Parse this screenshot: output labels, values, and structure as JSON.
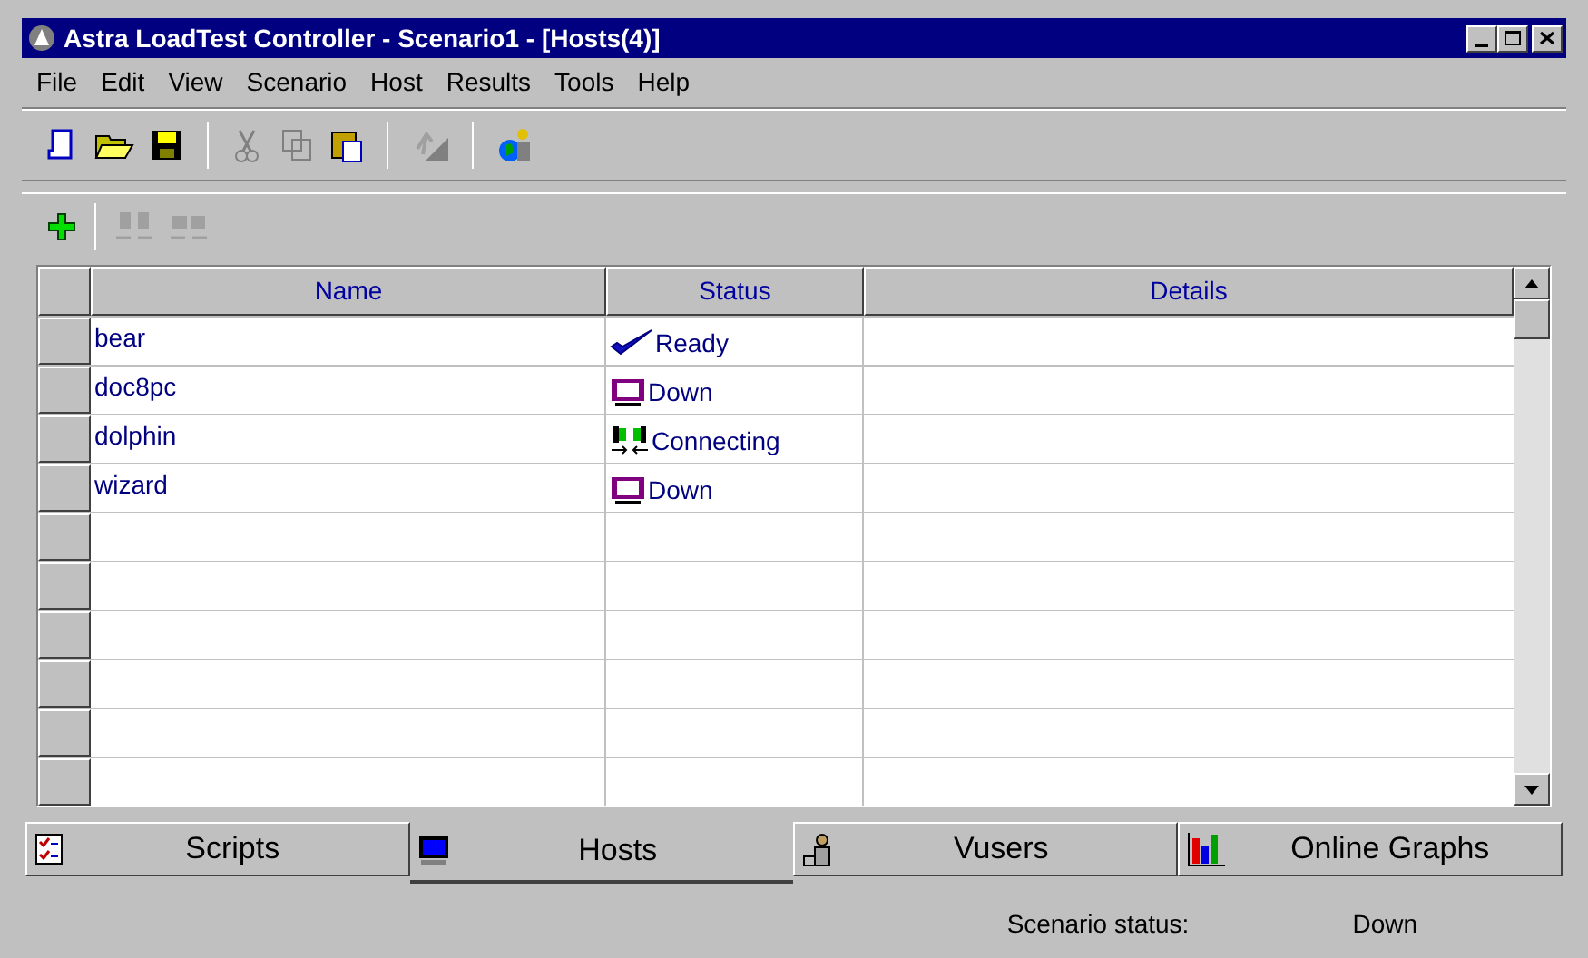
{
  "window": {
    "title": "Astra LoadTest Controller - Scenario1 - [Hosts(4)]"
  },
  "menu": [
    "File",
    "Edit",
    "View",
    "Scenario",
    "Host",
    "Results",
    "Tools",
    "Help"
  ],
  "table": {
    "columns": [
      "Name",
      "Status",
      "Details"
    ],
    "rows": [
      {
        "name": "bear",
        "status": {
          "kind": "ready",
          "label": "Ready"
        }
      },
      {
        "name": "doc8pc",
        "status": {
          "kind": "down",
          "label": "Down"
        }
      },
      {
        "name": "dolphin",
        "status": {
          "kind": "connecting",
          "label": "Connecting"
        }
      },
      {
        "name": "wizard",
        "status": {
          "kind": "down",
          "label": "Down"
        }
      }
    ]
  },
  "tabs": [
    {
      "label": "Scripts",
      "selected": false,
      "kind": "scripts"
    },
    {
      "label": "Hosts",
      "selected": true,
      "kind": "hosts"
    },
    {
      "label": "Vusers",
      "selected": false,
      "kind": "vusers"
    },
    {
      "label": "Online Graphs",
      "selected": false,
      "kind": "graphs"
    }
  ],
  "status_bar": {
    "label": "Scenario status:",
    "value": "Down"
  }
}
